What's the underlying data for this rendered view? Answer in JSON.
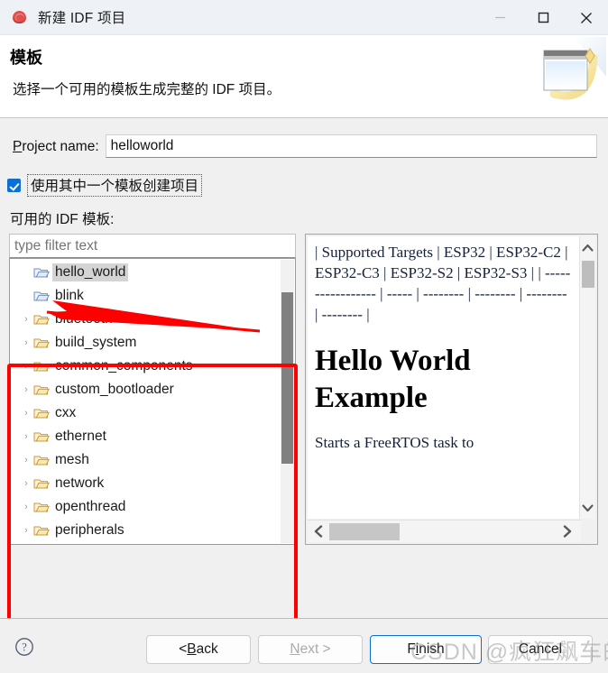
{
  "window": {
    "title": "新建 IDF 项目",
    "icon": "espressif-logo-icon",
    "minimize_label": "—",
    "maximize_label": "□",
    "close_label": "✕"
  },
  "header": {
    "title": "模板",
    "subtitle": "选择一个可用的模板生成完整的 IDF 项目。",
    "art": "new-project-wizard-banner-icon"
  },
  "form": {
    "project_name_label_pre": "P",
    "project_name_label_post": "roject name:",
    "project_name_value": "helloworld",
    "use_template_checkbox_label": "使用其中一个模板创建项目",
    "use_template_checked": true,
    "available_templates_label": "可用的 IDF 模板:"
  },
  "tree": {
    "filter_placeholder": "type filter text",
    "filter_value": "",
    "items": [
      {
        "label": "hello_world",
        "expandable": false,
        "selected": true,
        "folder": "leaf"
      },
      {
        "label": "blink",
        "expandable": false,
        "selected": false,
        "folder": "leaf"
      },
      {
        "label": "bluetooth",
        "expandable": true,
        "selected": false,
        "folder": "group"
      },
      {
        "label": "build_system",
        "expandable": true,
        "selected": false,
        "folder": "group"
      },
      {
        "label": "common_components",
        "expandable": true,
        "selected": false,
        "folder": "group"
      },
      {
        "label": "custom_bootloader",
        "expandable": true,
        "selected": false,
        "folder": "group"
      },
      {
        "label": "cxx",
        "expandable": true,
        "selected": false,
        "folder": "group"
      },
      {
        "label": "ethernet",
        "expandable": true,
        "selected": false,
        "folder": "group"
      },
      {
        "label": "mesh",
        "expandable": true,
        "selected": false,
        "folder": "group"
      },
      {
        "label": "network",
        "expandable": true,
        "selected": false,
        "folder": "group"
      },
      {
        "label": "openthread",
        "expandable": true,
        "selected": false,
        "folder": "group"
      },
      {
        "label": "peripherals",
        "expandable": true,
        "selected": false,
        "folder": "group"
      }
    ],
    "expand_glyph": "›"
  },
  "description": {
    "targets_line": "| Supported Targets | ESP32 | ESP32-C2 | ESP32-C3 | ESP32-S2 | ESP32-S3 | | -----------------  | ----- | -------- | -------- | -------- | -------- |",
    "heading": "Hello World Example",
    "body": "Starts a FreeRTOS task to",
    "scroll_up_glyph": "︿",
    "scroll_down_glyph": "﹀",
    "scroll_left_glyph": "❮",
    "scroll_right_glyph": "❯"
  },
  "footer": {
    "help_label": "?",
    "back_label_pre": "< ",
    "back_label_mnemonic": "B",
    "back_label_post": "ack",
    "next_label_mnemonic": "N",
    "next_label_post": "ext >",
    "finish_label_pre": "F",
    "finish_label_mnemonic": "i",
    "finish_label_post": "nish",
    "cancel_label": "Cancel"
  },
  "annotations": {
    "highlight_rect": "red-highlight-rectangle",
    "pointer_arrow": "red-pointer-arrow",
    "watermark": "CSDN @疯狂飙车的蜗牛"
  },
  "colors": {
    "accent": "#0b6fd4",
    "annotation": "#ff0000",
    "dialog_bg": "#f0f0f0",
    "titlebar_bg": "#eef1f6"
  }
}
